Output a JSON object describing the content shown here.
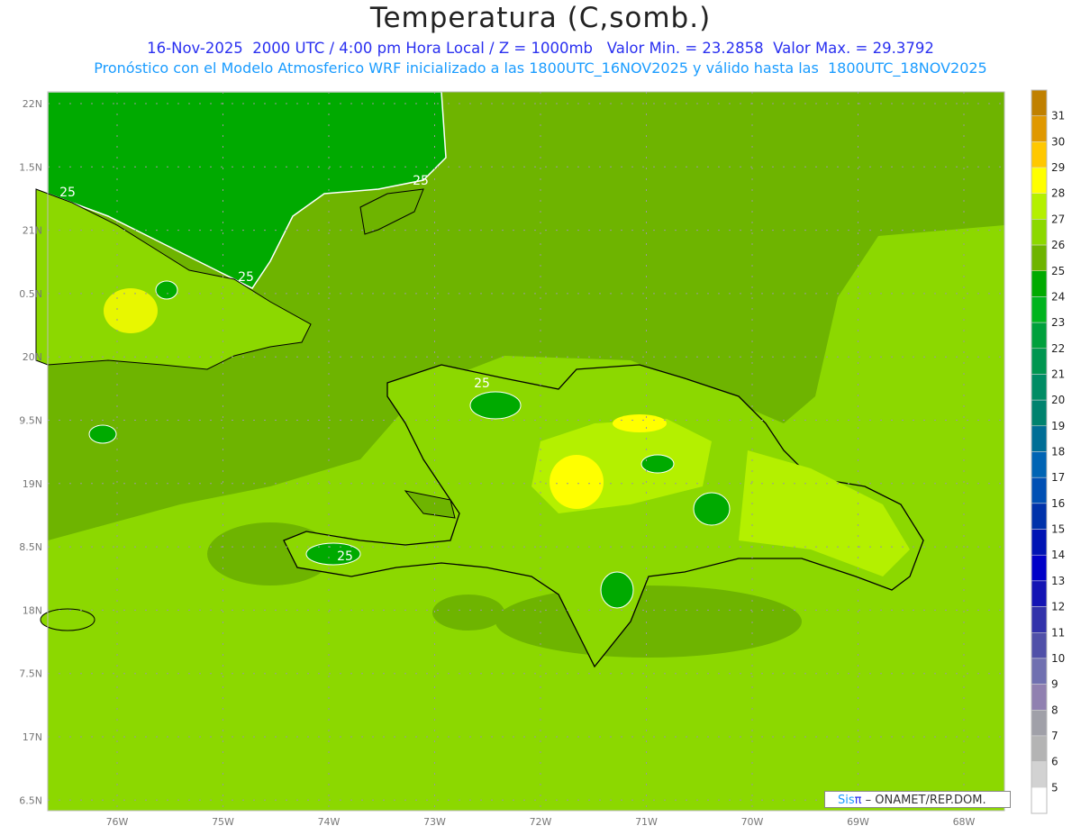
{
  "header": {
    "title": "Temperatura (C,somb.)",
    "line2": "16-Nov-2025  2000 UTC / 4:00 pm Hora Local / Z = 1000mb   Valor Min. = 23.2858  Valor Max. = 29.3792",
    "line3": "Pronóstico con el Modelo Atmosferico WRF inicializado a las 1800UTC_16NOV2025 y válido hasta las  1800UTC_18NOV2025"
  },
  "logo": {
    "sis": "Sis",
    "pi": "π",
    "rest": " – ONAMET/REP.DOM."
  },
  "chart_data": {
    "type": "heatmap",
    "title": "Temperatura (C,somb.)",
    "variable": "Temperature 1000mb (C)",
    "value_min": 23.2858,
    "value_max": 29.3792,
    "contour_label": "25",
    "x_ticks": [
      "76W",
      "75W",
      "74W",
      "73W",
      "72W",
      "71W",
      "70W",
      "69W",
      "68W"
    ],
    "y_ticks": [
      "22N",
      "1.5N",
      "21N",
      "0.5N",
      "20N",
      "9.5N",
      "19N",
      "8.5N",
      "18N",
      "7.5N",
      "17N",
      "6.5N"
    ],
    "colorbar": {
      "labels": [
        "31",
        "30",
        "29",
        "28",
        "27",
        "26",
        "25",
        "24",
        "23",
        "22",
        "21",
        "20",
        "19",
        "18",
        "17",
        "16",
        "15",
        "14",
        "13",
        "12",
        "11",
        "10",
        "9",
        "8",
        "7",
        "6",
        "5"
      ],
      "colors": [
        "#c08000",
        "#e09800",
        "#ffc800",
        "#ffff00",
        "#b4f000",
        "#8cd800",
        "#6eb400",
        "#00aa00",
        "#00b41e",
        "#00a03c",
        "#009650",
        "#008c64",
        "#00826e",
        "#006e96",
        "#0064b4",
        "#0050b4",
        "#0032aa",
        "#0014b4",
        "#0000c8",
        "#1414b4",
        "#3232aa",
        "#5050a8",
        "#7070b0",
        "#9080b0",
        "#a0a0a8",
        "#b4b4b4",
        "#d2d2d2",
        "#ffffff"
      ]
    }
  }
}
